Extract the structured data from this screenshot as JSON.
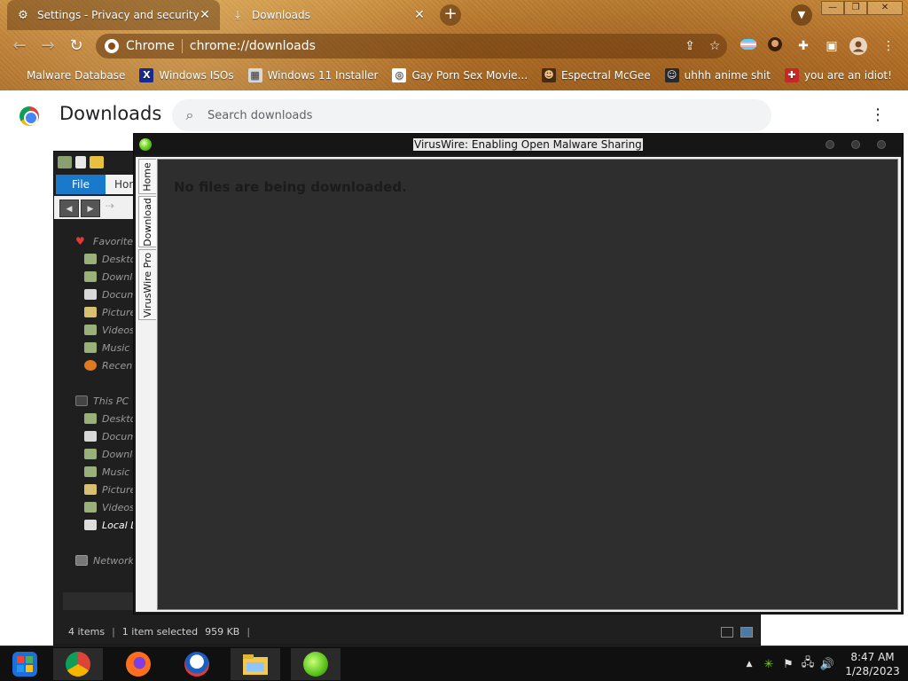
{
  "tabs": [
    {
      "title": "Settings - Privacy and security",
      "icon": "gear-icon",
      "active": true
    },
    {
      "title": "Downloads",
      "icon": "download-icon",
      "active": false
    }
  ],
  "toolbar": {
    "site_name": "Chrome",
    "url": "chrome://downloads"
  },
  "bookmarks": [
    {
      "label": "Malware Database",
      "icon": "none"
    },
    {
      "label": "Windows ISOs",
      "icon": "x-logo-icon"
    },
    {
      "label": "Windows 11 Installer",
      "icon": "image-icon"
    },
    {
      "label": "Gay Porn Sex Movie...",
      "icon": "favicon-icon"
    },
    {
      "label": "Espectral McGee",
      "icon": "avatar-icon"
    },
    {
      "label": "uhhh anime shit",
      "icon": "anime-icon"
    },
    {
      "label": "you are an idiot!",
      "icon": "flag-icon"
    }
  ],
  "downloads_page": {
    "title": "Downloads",
    "search_placeholder": "Search downloads"
  },
  "explorer": {
    "ribbon": {
      "file": "File",
      "home": "Hor"
    },
    "favorites_label": "Favorites",
    "favorites": [
      "Deskto",
      "Downlo",
      "Docum",
      "Picture",
      "Videos",
      "Music",
      "Recent"
    ],
    "thispc_label": "This PC",
    "thispc": [
      "Deskto",
      "Docum",
      "Downlo",
      "Music",
      "Picture",
      "Videos",
      "Local D"
    ],
    "network_label": "Network",
    "status": {
      "items": "4 items",
      "selected": "1 item selected",
      "size": "959 KB"
    }
  },
  "viruswire": {
    "title": "VirusWire: Enabling Open Malware Sharing",
    "tabs": [
      "Home",
      "Download",
      "VirusWire Pro"
    ],
    "active_tab": "Download",
    "empty_message": "No files are being downloaded."
  },
  "taskbar": {
    "apps": [
      "Start",
      "Chrome",
      "Firefox",
      "Campaign",
      "File Explorer",
      "VirusWire"
    ],
    "time": "8:47 AM",
    "date": "1/28/2023"
  }
}
